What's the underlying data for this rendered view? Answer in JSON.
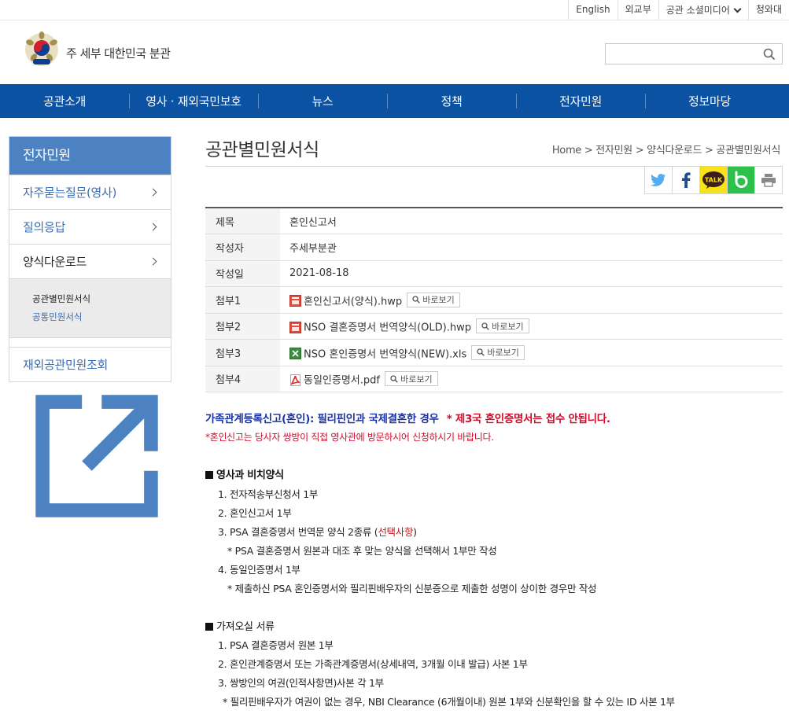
{
  "topbar": {
    "english": "English",
    "mofa": "외교부",
    "social": "공관 소셜미디어",
    "bluehouse": "청와대"
  },
  "header": {
    "site_title": "주 세부 대한민국 분관",
    "search_placeholder": ""
  },
  "gnb": [
    "공관소개",
    "영사 · 재외국민보호",
    "뉴스",
    "정책",
    "전자민원",
    "정보마당"
  ],
  "lnb": {
    "title": "전자민원",
    "items": [
      "자주묻는질문(영사)",
      "질의응답",
      "양식다운로드"
    ],
    "sub": [
      "공관별민원서식",
      "공통민원서식"
    ],
    "external": "재외공관민원조회"
  },
  "content": {
    "title": "공관별민원서식",
    "breadcrumb": "Home > 전자민원 > 양식다운로드 > 공관별민원서식",
    "info": {
      "subject_label": "제목",
      "subject": "혼인신고서",
      "author_label": "작성자",
      "author": "주세부분관",
      "date_label": "작성일",
      "date": "2021-08-18",
      "attachments": [
        {
          "label": "첨부1",
          "name": "혼인신고서(양식).hwp",
          "type": "hwp"
        },
        {
          "label": "첨부2",
          "name": "NSO 결혼증명서 번역양식(OLD).hwp",
          "type": "hwp"
        },
        {
          "label": "첨부3",
          "name": "NSO 혼인증명서 번역양식(NEW).xls",
          "type": "xls"
        },
        {
          "label": "첨부4",
          "name": "동일인증명서.pdf",
          "type": "pdf"
        }
      ],
      "view_label": "바로보기"
    },
    "notice1": "가족관계등록신고(혼인): 필리핀인과 국제결혼한 경우",
    "notice1_red": "* 제3국 혼인증명서는 접수 안됩니다.",
    "notice2": "*혼인신고는 당사자 쌍방이 직접 영사관에 방문하시어 신청하시기 바랍니다.",
    "section1": {
      "title": "영사과 비치양식",
      "l1": "1. 전자적송부신청서 1부",
      "l2": "2. 혼인신고서 1부",
      "l3": "3. PSA 결혼증명서 번역문 양식 2종류 (",
      "l3_red": "선택사항",
      "l3_end": ")",
      "l3_note": "* PSA 결혼증명서 원본과 대조 후 맞는 양식을 선택해서 1부만 작성",
      "l4": "4. 동일인증명서 1부",
      "l4_note": "* 제출하신 PSA 혼인증명서와 필리핀배우자의 신분증으로 제출한 성명이 상이한 경우만 작성"
    },
    "section2": {
      "title": "가져오실 서류",
      "l1": "1.  PSA 결혼증명서 원본 1부",
      "l2": "2.  혼인관계증명서 또는 가족관계증명서(상세내역, 3개월 이내 발급) 사본 1부",
      "l3": "3.  쌍방인의 여권(인적사항면)사본 각 1부",
      "l3_note": "* 필리핀배우자가 여권이 없는 경우, NBI Clearance (6개월이내) 원본 1부와 신분확인을 할 수 있는 ID 사본 1부"
    }
  }
}
